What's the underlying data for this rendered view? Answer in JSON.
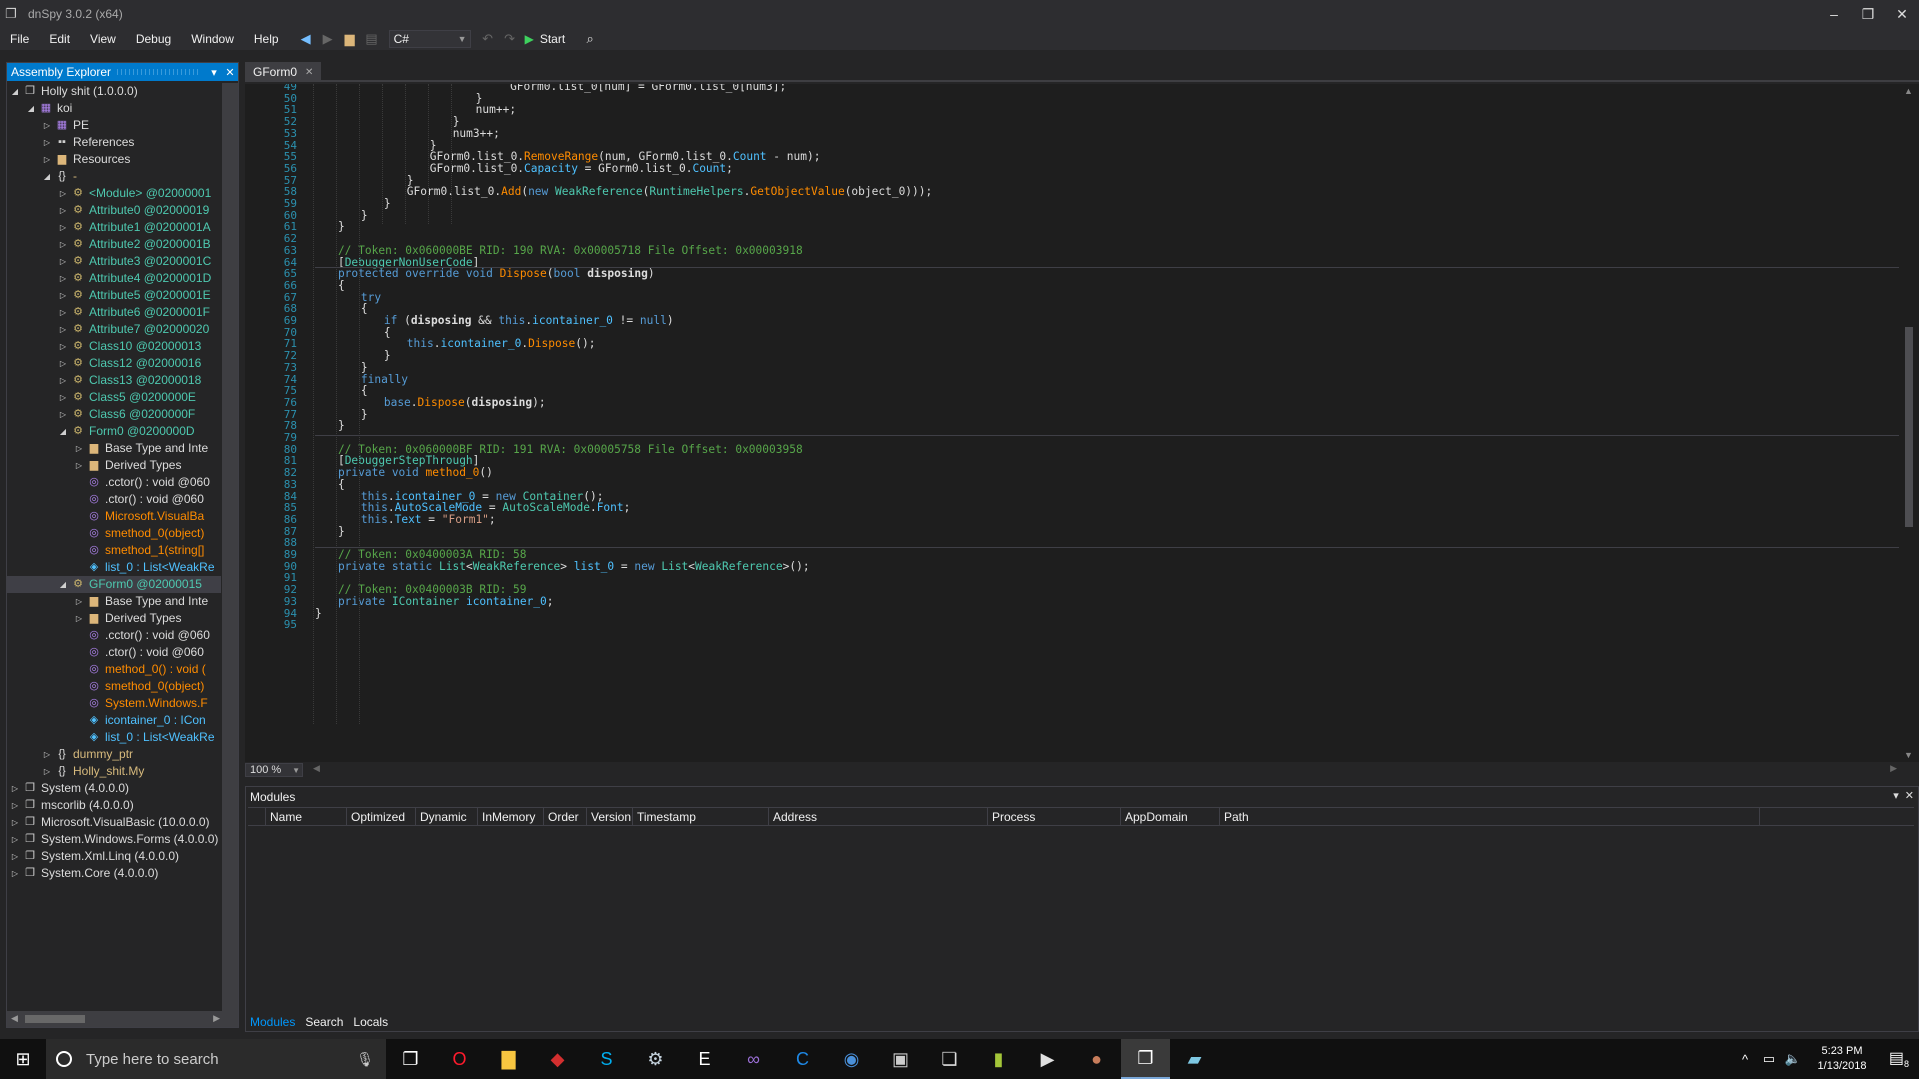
{
  "window": {
    "title": "dnSpy 3.0.2 (x64)",
    "controls": [
      "–",
      "❐",
      "✕"
    ]
  },
  "menu": [
    "File",
    "Edit",
    "View",
    "Debug",
    "Window",
    "Help"
  ],
  "toolbar": {
    "language": "C#",
    "start_label": "Start"
  },
  "assembly_explorer": {
    "title": "Assembly Explorer",
    "tree": [
      {
        "indent": 0,
        "tw": "◢",
        "icon": "asm",
        "label": "Holly shit (1.0.0.0)",
        "cls": "c-white"
      },
      {
        "indent": 1,
        "tw": "◢",
        "icon": "module",
        "label": "koi",
        "cls": "c-white"
      },
      {
        "indent": 2,
        "tw": "▷",
        "icon": "pe",
        "label": "PE",
        "cls": "c-white"
      },
      {
        "indent": 2,
        "tw": "▷",
        "icon": "refs",
        "label": "References",
        "cls": "c-white"
      },
      {
        "indent": 2,
        "tw": "▷",
        "icon": "folder",
        "label": "Resources",
        "cls": "c-white"
      },
      {
        "indent": 2,
        "tw": "◢",
        "icon": "ns",
        "label": "-",
        "cls": "c-ns"
      },
      {
        "indent": 3,
        "tw": "▷",
        "icon": "class",
        "label": "<Module> @02000001",
        "cls": "c-type"
      },
      {
        "indent": 3,
        "tw": "▷",
        "icon": "class",
        "label": "Attribute0 @02000019",
        "cls": "c-type"
      },
      {
        "indent": 3,
        "tw": "▷",
        "icon": "class",
        "label": "Attribute1 @0200001A",
        "cls": "c-type"
      },
      {
        "indent": 3,
        "tw": "▷",
        "icon": "class",
        "label": "Attribute2 @0200001B",
        "cls": "c-type"
      },
      {
        "indent": 3,
        "tw": "▷",
        "icon": "class",
        "label": "Attribute3 @0200001C",
        "cls": "c-type"
      },
      {
        "indent": 3,
        "tw": "▷",
        "icon": "class",
        "label": "Attribute4 @0200001D",
        "cls": "c-type"
      },
      {
        "indent": 3,
        "tw": "▷",
        "icon": "class",
        "label": "Attribute5 @0200001E",
        "cls": "c-type"
      },
      {
        "indent": 3,
        "tw": "▷",
        "icon": "class",
        "label": "Attribute6 @0200001F",
        "cls": "c-type"
      },
      {
        "indent": 3,
        "tw": "▷",
        "icon": "class",
        "label": "Attribute7 @02000020",
        "cls": "c-type"
      },
      {
        "indent": 3,
        "tw": "▷",
        "icon": "class",
        "label": "Class10 @02000013",
        "cls": "c-type"
      },
      {
        "indent": 3,
        "tw": "▷",
        "icon": "class",
        "label": "Class12 @02000016",
        "cls": "c-type"
      },
      {
        "indent": 3,
        "tw": "▷",
        "icon": "class",
        "label": "Class13 @02000018",
        "cls": "c-type"
      },
      {
        "indent": 3,
        "tw": "▷",
        "icon": "class",
        "label": "Class5 @0200000E",
        "cls": "c-type"
      },
      {
        "indent": 3,
        "tw": "▷",
        "icon": "class",
        "label": "Class6 @0200000F",
        "cls": "c-type"
      },
      {
        "indent": 3,
        "tw": "◢",
        "icon": "class",
        "label": "Form0 @0200000D",
        "cls": "c-type"
      },
      {
        "indent": 4,
        "tw": "▷",
        "icon": "folder",
        "label": "Base Type and Inte",
        "cls": "c-white"
      },
      {
        "indent": 4,
        "tw": "▷",
        "icon": "folder",
        "label": "Derived Types",
        "cls": "c-white"
      },
      {
        "indent": 4,
        "tw": "",
        "icon": "method",
        "label": ".cctor() : void @060",
        "cls": "c-white"
      },
      {
        "indent": 4,
        "tw": "",
        "icon": "method",
        "label": ".ctor() : void @060",
        "cls": "c-white"
      },
      {
        "indent": 4,
        "tw": "",
        "icon": "method",
        "label": "Microsoft.VisualBa",
        "cls": "c-method"
      },
      {
        "indent": 4,
        "tw": "",
        "icon": "method",
        "label": "smethod_0(object)",
        "cls": "c-method"
      },
      {
        "indent": 4,
        "tw": "",
        "icon": "method",
        "label": "smethod_1(string[]",
        "cls": "c-method"
      },
      {
        "indent": 4,
        "tw": "",
        "icon": "field",
        "label": "list_0 : List<WeakRe",
        "cls": "c-field"
      },
      {
        "indent": 3,
        "tw": "◢",
        "icon": "class",
        "label": "GForm0 @02000015",
        "cls": "c-type",
        "selected": true
      },
      {
        "indent": 4,
        "tw": "▷",
        "icon": "folder",
        "label": "Base Type and Inte",
        "cls": "c-white"
      },
      {
        "indent": 4,
        "tw": "▷",
        "icon": "folder",
        "label": "Derived Types",
        "cls": "c-white"
      },
      {
        "indent": 4,
        "tw": "",
        "icon": "method",
        "label": ".cctor() : void @060",
        "cls": "c-white"
      },
      {
        "indent": 4,
        "tw": "",
        "icon": "method",
        "label": ".ctor() : void @060",
        "cls": "c-white"
      },
      {
        "indent": 4,
        "tw": "",
        "icon": "method",
        "label": "method_0() : void (",
        "cls": "c-method"
      },
      {
        "indent": 4,
        "tw": "",
        "icon": "method",
        "label": "smethod_0(object)",
        "cls": "c-method"
      },
      {
        "indent": 4,
        "tw": "",
        "icon": "method",
        "label": "System.Windows.F",
        "cls": "c-method"
      },
      {
        "indent": 4,
        "tw": "",
        "icon": "field",
        "label": "icontainer_0 : ICon",
        "cls": "c-field"
      },
      {
        "indent": 4,
        "tw": "",
        "icon": "field",
        "label": "list_0 : List<WeakRe",
        "cls": "c-field"
      },
      {
        "indent": 2,
        "tw": "▷",
        "icon": "ns",
        "label": "dummy_ptr",
        "cls": "c-ns"
      },
      {
        "indent": 2,
        "tw": "▷",
        "icon": "ns",
        "label": "Holly_shit.My",
        "cls": "c-ns"
      },
      {
        "indent": 0,
        "tw": "▷",
        "icon": "asm",
        "label": "System (4.0.0.0)",
        "cls": "c-white"
      },
      {
        "indent": 0,
        "tw": "▷",
        "icon": "asm",
        "label": "mscorlib (4.0.0.0)",
        "cls": "c-white"
      },
      {
        "indent": 0,
        "tw": "▷",
        "icon": "asm",
        "label": "Microsoft.VisualBasic (10.0.0.0)",
        "cls": "c-white"
      },
      {
        "indent": 0,
        "tw": "▷",
        "icon": "asm",
        "label": "System.Windows.Forms (4.0.0.0)",
        "cls": "c-white"
      },
      {
        "indent": 0,
        "tw": "▷",
        "icon": "asm",
        "label": "System.Xml.Linq (4.0.0.0)",
        "cls": "c-white"
      },
      {
        "indent": 0,
        "tw": "▷",
        "icon": "asm",
        "label": "System.Core (4.0.0.0)",
        "cls": "c-white"
      }
    ]
  },
  "editor": {
    "tab": "GForm0",
    "zoom": "100 %",
    "lines": [
      {
        "n": "49",
        "i": 17,
        "h": "GForm0.list_0[num] = GForm0.list_0[num3];"
      },
      {
        "n": "50",
        "i": 14,
        "h": "}"
      },
      {
        "n": "51",
        "i": 14,
        "h": "num++;"
      },
      {
        "n": "52",
        "i": 12,
        "h": "}"
      },
      {
        "n": "53",
        "i": 12,
        "h": "num3++;"
      },
      {
        "n": "54",
        "i": 10,
        "h": "}"
      },
      {
        "n": "55",
        "i": 10,
        "h": "GForm0.list_0.<span class='m'>RemoveRange</span>(num, GForm0.list_0.<span class='pr'>Count</span> - num);"
      },
      {
        "n": "56",
        "i": 10,
        "h": "GForm0.list_0.<span class='pr'>Capacity</span> = GForm0.list_0.<span class='pr'>Count</span>;"
      },
      {
        "n": "57",
        "i": 8,
        "h": "}"
      },
      {
        "n": "58",
        "i": 8,
        "h": "GForm0.list_0.<span class='m'>Add</span>(<span class='k'>new</span> <span class='t'>WeakReference</span>(<span class='t'>RuntimeHelpers</span>.<span class='m'>GetObjectValue</span>(object_0)));"
      },
      {
        "n": "59",
        "i": 6,
        "h": "}"
      },
      {
        "n": "60",
        "i": 4,
        "h": "}"
      },
      {
        "n": "61",
        "i": 2,
        "h": "}"
      },
      {
        "n": "62",
        "i": 0,
        "h": ""
      },
      {
        "n": "63",
        "i": 2,
        "h": "<span class='c'>// Token: 0x060000BE RID: 190 RVA: 0x00005718 File Offset: 0x00003918</span>"
      },
      {
        "n": "64",
        "i": 2,
        "h": "[<span class='t'>DebuggerNonUserCode</span>]"
      },
      {
        "n": "65",
        "i": 2,
        "h": "<span class='k'>protected override void</span> <span class='m'>Dispose</span>(<span class='k'>bool</span> <span class='b'>disposing</span>)"
      },
      {
        "n": "66",
        "i": 2,
        "h": "{"
      },
      {
        "n": "67",
        "i": 4,
        "h": "<span class='k'>try</span>"
      },
      {
        "n": "68",
        "i": 4,
        "h": "{"
      },
      {
        "n": "69",
        "i": 6,
        "h": "<span class='k'>if</span> (<span class='b'>disposing</span> &amp;&amp; <span class='k'>this</span>.<span class='pr'>icontainer_0</span> != <span class='k'>null</span>)"
      },
      {
        "n": "70",
        "i": 6,
        "h": "{"
      },
      {
        "n": "71",
        "i": 8,
        "h": "<span class='k'>this</span>.<span class='pr'>icontainer_0</span>.<span class='m'>Dispose</span>();"
      },
      {
        "n": "72",
        "i": 6,
        "h": "}"
      },
      {
        "n": "73",
        "i": 4,
        "h": "}"
      },
      {
        "n": "74",
        "i": 4,
        "h": "<span class='k'>finally</span>"
      },
      {
        "n": "75",
        "i": 4,
        "h": "{"
      },
      {
        "n": "76",
        "i": 6,
        "h": "<span class='k'>base</span>.<span class='m'>Dispose</span>(<span class='b'>disposing</span>);"
      },
      {
        "n": "77",
        "i": 4,
        "h": "}"
      },
      {
        "n": "78",
        "i": 2,
        "h": "}"
      },
      {
        "n": "79",
        "i": 0,
        "h": ""
      },
      {
        "n": "80",
        "i": 2,
        "h": "<span class='c'>// Token: 0x060000BF RID: 191 RVA: 0x00005758 File Offset: 0x00003958</span>"
      },
      {
        "n": "81",
        "i": 2,
        "h": "[<span class='t'>DebuggerStepThrough</span>]"
      },
      {
        "n": "82",
        "i": 2,
        "h": "<span class='k'>private void</span> <span class='m'>method_0</span>()"
      },
      {
        "n": "83",
        "i": 2,
        "h": "{"
      },
      {
        "n": "84",
        "i": 4,
        "h": "<span class='k'>this</span>.<span class='pr'>icontainer_0</span> = <span class='k'>new</span> <span class='t'>Container</span>();"
      },
      {
        "n": "85",
        "i": 4,
        "h": "<span class='k'>this</span>.<span class='pr'>AutoScaleMode</span> = <span class='t'>AutoScaleMode</span>.<span class='pr'>Font</span>;"
      },
      {
        "n": "86",
        "i": 4,
        "h": "<span class='k'>this</span>.<span class='pr'>Text</span> = <span class='s'>\"Form1\"</span>;"
      },
      {
        "n": "87",
        "i": 2,
        "h": "}"
      },
      {
        "n": "88",
        "i": 0,
        "h": ""
      },
      {
        "n": "89",
        "i": 2,
        "h": "<span class='c'>// Token: 0x0400003A RID: 58</span>"
      },
      {
        "n": "90",
        "i": 2,
        "h": "<span class='k'>private static</span> <span class='t'>List</span>&lt;<span class='t'>WeakReference</span>&gt; <span class='pr'>list_0</span> = <span class='k'>new</span> <span class='t'>List</span>&lt;<span class='t'>WeakReference</span>&gt;();"
      },
      {
        "n": "91",
        "i": 0,
        "h": ""
      },
      {
        "n": "92",
        "i": 2,
        "h": "<span class='c'>// Token: 0x0400003B RID: 59</span>"
      },
      {
        "n": "93",
        "i": 2,
        "h": "<span class='k'>private</span> <span class='t'>IContainer</span> <span class='pr'>icontainer_0</span>;"
      },
      {
        "n": "94",
        "i": 0,
        "h": "}"
      },
      {
        "n": "95",
        "i": 0,
        "h": ""
      }
    ]
  },
  "modules": {
    "title": "Modules",
    "columns": [
      "Name",
      "Optimized",
      "Dynamic",
      "InMemory",
      "Order",
      "Version",
      "Timestamp",
      "Address",
      "Process",
      "AppDomain",
      "Path"
    ]
  },
  "bottom_tabs": [
    "Modules",
    "Search",
    "Locals"
  ],
  "taskbar": {
    "search_placeholder": "Type here to search",
    "apps": [
      {
        "name": "task-view-icon",
        "glyph": "❐",
        "color": "#ffffff"
      },
      {
        "name": "opera-icon",
        "glyph": "O",
        "color": "#ff1b2d"
      },
      {
        "name": "file-explorer-icon",
        "glyph": "▇",
        "color": "#f8c640"
      },
      {
        "name": "red-app-icon",
        "glyph": "◆",
        "color": "#d32f2f"
      },
      {
        "name": "skype-icon",
        "glyph": "S",
        "color": "#00aff0"
      },
      {
        "name": "steam-icon",
        "glyph": "⚙",
        "color": "#c7d5e0"
      },
      {
        "name": "epic-games-icon",
        "glyph": "E",
        "color": "#ffffff"
      },
      {
        "name": "visual-studio-icon",
        "glyph": "∞",
        "color": "#9b6fd6"
      },
      {
        "name": "ccleaner-icon",
        "glyph": "C",
        "color": "#1e88e5"
      },
      {
        "name": "chat-app-icon",
        "glyph": "◉",
        "color": "#4a90d9"
      },
      {
        "name": "device-app-icon",
        "glyph": "▣",
        "color": "#cccccc"
      },
      {
        "name": "window-app-icon",
        "glyph": "❏",
        "color": "#dddddd"
      },
      {
        "name": "notes-app-icon",
        "glyph": "▮",
        "color": "#a4c639"
      },
      {
        "name": "media-player-icon",
        "glyph": "▶",
        "color": "#e0e0e0"
      },
      {
        "name": "photo-app-icon",
        "glyph": "●",
        "color": "#c87d5b"
      },
      {
        "name": "dnspy-taskbar-icon",
        "glyph": "❐",
        "color": "#ffffff",
        "active": true
      },
      {
        "name": "paint-app-icon",
        "glyph": "▰",
        "color": "#7ec8e3"
      }
    ],
    "time": "5:23 PM",
    "date": "1/13/2018",
    "notif_count": "8"
  }
}
